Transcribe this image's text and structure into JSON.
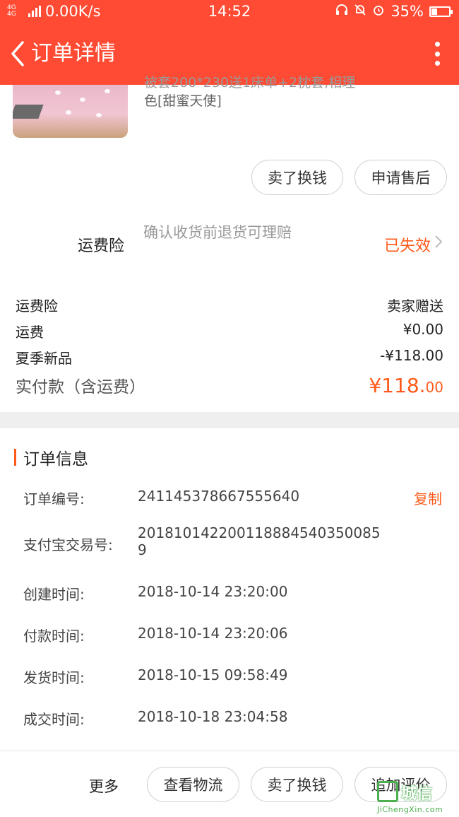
{
  "status_bar": {
    "network": "4G 4G",
    "speed": "0.00K/s",
    "time": "14:52",
    "battery_percent": "35%",
    "battery_level": 0.35
  },
  "nav": {
    "title": "订单详情",
    "back_icon": "chevron-left-icon",
    "more_icon": "more-vertical-icon"
  },
  "product": {
    "desc_line1": "被套200*230送1床单+2枕套,相理",
    "desc_line2": "色[甜蜜天使]"
  },
  "actions": {
    "sell_exchange": "卖了换钱",
    "after_sale": "申请售后"
  },
  "insurance": {
    "label": "运费险",
    "desc": "确认收货前退货可理赔",
    "status": "已失效",
    "status_color": "#ff5a1a"
  },
  "fees": [
    {
      "label": "运费险",
      "value": "卖家赠送"
    },
    {
      "label": "运费",
      "value": "¥0.00"
    },
    {
      "label": "夏季新品",
      "value": "-¥118.00"
    }
  ],
  "total": {
    "label": "实付款（含运费）",
    "value_main": "¥118.",
    "value_decimal": "00"
  },
  "order_info": {
    "title": "订单信息",
    "copy_label": "复制",
    "items": [
      {
        "label": "订单编号:",
        "value": "241145378667555640"
      },
      {
        "label": "支付宝交易号:",
        "value": "2018101422001188845403500859"
      },
      {
        "label": "创建时间:",
        "value": "2018-10-14 23:20:00"
      },
      {
        "label": "付款时间:",
        "value": "2018-10-14 23:20:06"
      },
      {
        "label": "发货时间:",
        "value": "2018-10-15 09:58:49"
      },
      {
        "label": "成交时间:",
        "value": "2018-10-18 23:04:58"
      }
    ]
  },
  "bottom_bar": {
    "more": "更多",
    "logistics": "查看物流",
    "sell_exchange": "卖了换钱",
    "add_review": "追加评价"
  },
  "watermark": {
    "brand": "城信",
    "url": "JiChengXin.com"
  },
  "accent_color": "#ff4b33"
}
